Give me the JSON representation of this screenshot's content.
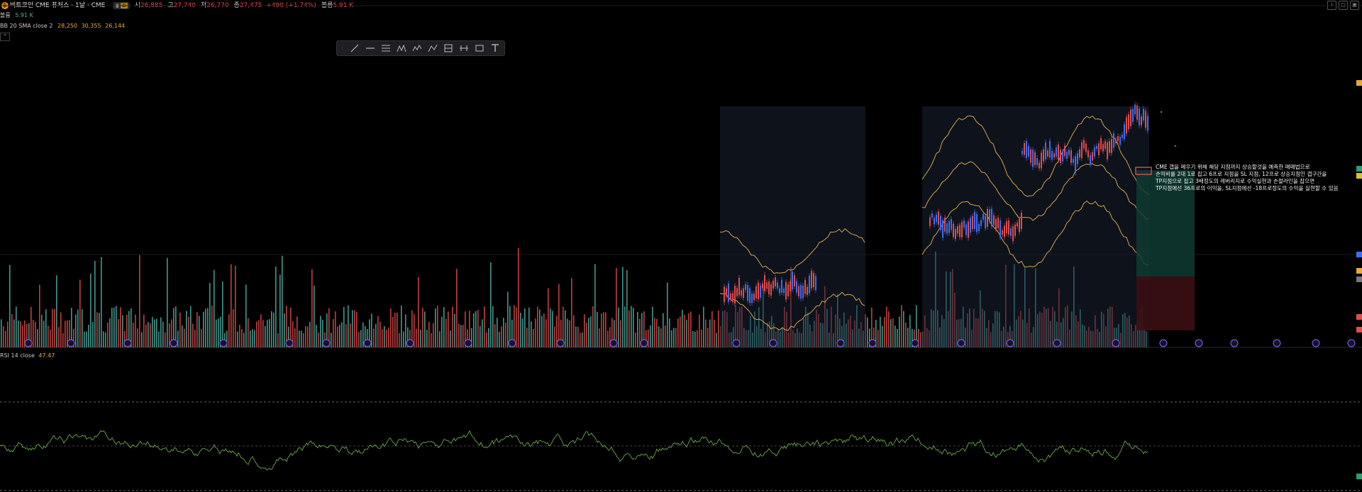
{
  "header": {
    "symbol_icon": "bitcoin-coin-icon",
    "title": "비트코인 CME 퓨처스 · 1날 · CME",
    "badge_d": "D",
    "open_label": "시",
    "open_value": "26,885",
    "high_label": "고",
    "high_value": "27,740",
    "low_label": "저",
    "low_value": "26,770",
    "close_label": "종",
    "close_value": "27,475",
    "change": "+490 (+1.74%)",
    "volume_label": "볼륨",
    "volume_value": "5.91 K"
  },
  "volume_row": {
    "label": "볼륨",
    "value": "5.91 K"
  },
  "bb_row": {
    "label": "BB 20 SMA close 2",
    "v1": "28,250",
    "v2": "30,355",
    "v3": "26,144"
  },
  "rsi_row": {
    "label": "RSI 14 close",
    "value": "47.47"
  },
  "toolbar": {
    "tools": [
      "trend-line-icon",
      "horizontal-line-icon",
      "fib-retracement-icon",
      "pattern-icon",
      "elliott-wave-icon",
      "path-icon",
      "long-position-icon",
      "date-range-icon",
      "rectangle-icon",
      "text-icon"
    ]
  },
  "annotation": {
    "lines": [
      "CME 갭을 메우기 위해 해당 지점까지 상승할것을 예측한 매매법으로",
      "손익비를 2대 1로 잡고  6프로 지점을 SL 지점, 12프로 상승지점인 갭구간을",
      "TP지점으로 잡고 3배정도의 레버리지로 수익실현과 손절라인을 잡으면",
      "TP지점에선 36프로의 이익을, SL지점에선 -18프로정도의 수익을 실현할 수 있음"
    ]
  },
  "colors": {
    "up": "#4fb2a4",
    "down": "#e24b4b",
    "bb": "#d6a24a",
    "bb_fill": "#1a2436",
    "rsi": "#6aa84f",
    "tp_zone": "#0f3b33",
    "sl_zone": "#3b0f14",
    "price_blue": "#3d6ef0"
  },
  "price_scale_tags": [
    "",
    "",
    "",
    "",
    "",
    "",
    ""
  ]
}
